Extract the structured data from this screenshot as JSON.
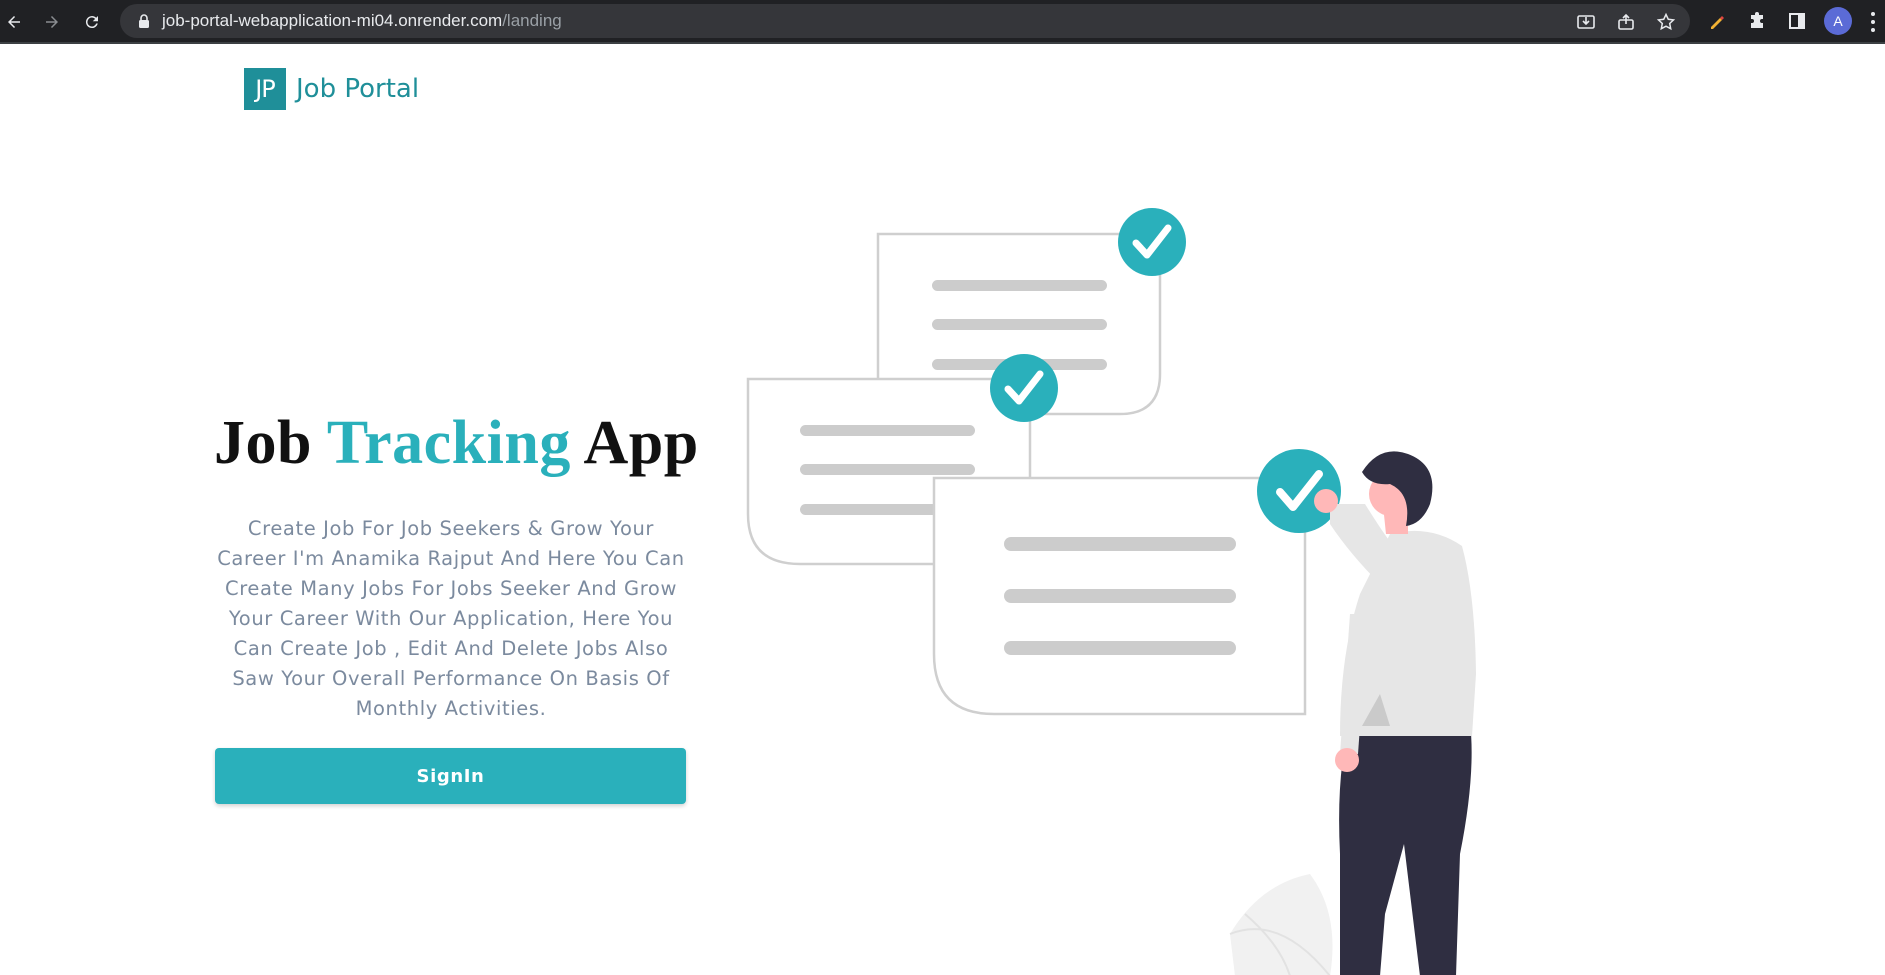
{
  "browser": {
    "url_host": "job-portal-webapplication-mi04.onrender.com",
    "url_path": "/landing",
    "profile_initial": "A"
  },
  "brand": {
    "logo_initials": "JP",
    "name": "Job Portal"
  },
  "hero": {
    "title_part1": "Job",
    "title_accent": "Tracking",
    "title_part2": "App",
    "description": "Create Job For Job Seekers & Grow Your Career I'm Anamika Rajput And Here You Can Create Many Jobs For Jobs Seeker And Grow Your Career With Our Application, Here You Can Create Job , Edit And Delete Jobs Also Saw Your Overall Performance On Basis Of Monthly Activities.",
    "signin_label": "SignIn"
  },
  "colors": {
    "accent": "#2ab0bb",
    "brand": "#1f8f99",
    "text_muted": "#7b8a9e",
    "chrome_bg": "#202124"
  },
  "icons": {
    "illustration": "job-checklist-illustration"
  }
}
